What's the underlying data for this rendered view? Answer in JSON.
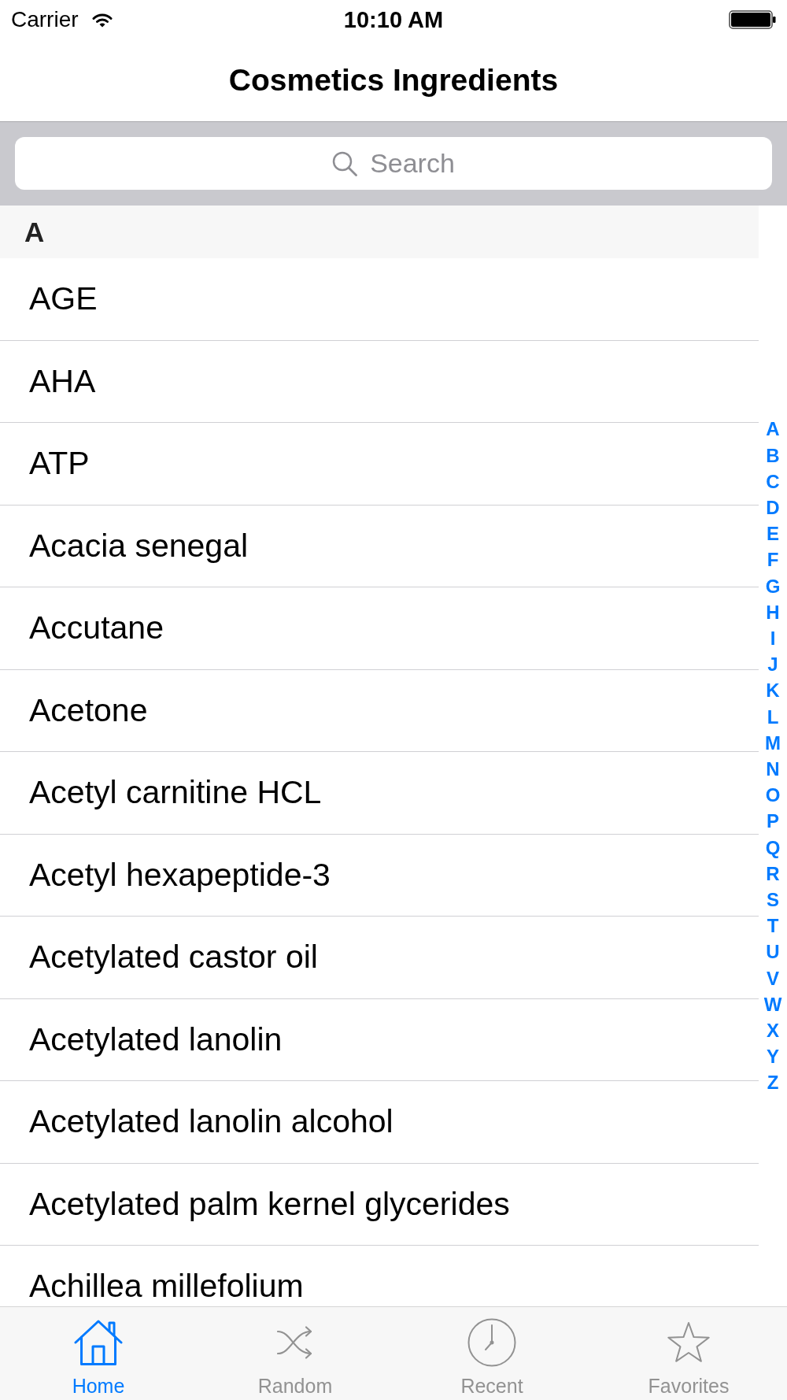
{
  "status_bar": {
    "carrier": "Carrier",
    "time": "10:10 AM"
  },
  "nav_bar": {
    "title": "Cosmetics Ingredients"
  },
  "search": {
    "placeholder": "Search"
  },
  "sections": [
    {
      "header": "A",
      "rows": [
        "AGE",
        "AHA",
        "ATP",
        "Acacia senegal",
        "Accutane",
        "Acetone",
        "Acetyl carnitine HCL",
        "Acetyl hexapeptide-3",
        "Acetylated castor oil",
        "Acetylated lanolin",
        "Acetylated lanolin alcohol",
        "Acetylated palm kernel glycerides",
        "Achillea millefolium"
      ]
    }
  ],
  "index": [
    "A",
    "B",
    "C",
    "D",
    "E",
    "F",
    "G",
    "H",
    "I",
    "J",
    "K",
    "L",
    "M",
    "N",
    "O",
    "P",
    "Q",
    "R",
    "S",
    "T",
    "U",
    "V",
    "W",
    "X",
    "Y",
    "Z"
  ],
  "tab_bar": {
    "tabs": [
      {
        "kind": "home",
        "label": "Home",
        "selected": true
      },
      {
        "kind": "random",
        "label": "Random",
        "selected": false
      },
      {
        "kind": "recent",
        "label": "Recent",
        "selected": false
      },
      {
        "kind": "favorites",
        "label": "Favorites",
        "selected": false
      }
    ]
  }
}
